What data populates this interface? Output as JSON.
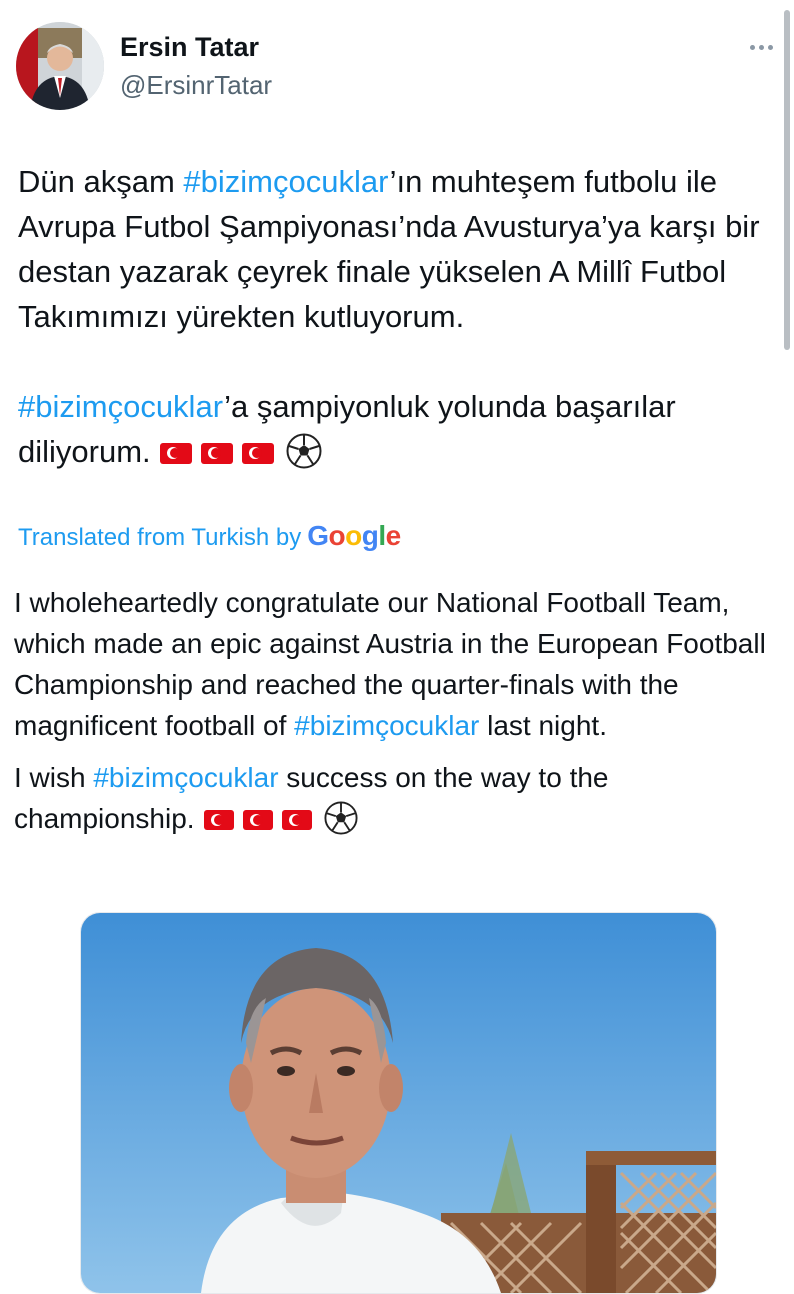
{
  "author": {
    "name": "Ersin Tatar",
    "handle": "@ErsinrTatar"
  },
  "icons": {
    "more": "more-horizontal-icon",
    "flag": "turkey-flag-emoji",
    "ball": "soccer-ball-emoji"
  },
  "tweet": {
    "p1_before": "Dün akşam ",
    "p1_tag": "#bizimçocuklar",
    "p1_after": "’ın muhteşem futbolu ile Avrupa Futbol Şampiyonası’nda Avusturya’ya karşı bir destan yazarak çeyrek finale yükselen A Millî Futbol Takımımızı yürekten kutluyorum.",
    "p2_tag": "#bizimçocuklar",
    "p2_after": "’a şampiyonluk yolunda başarılar diliyorum."
  },
  "translation": {
    "label": "Translated from Turkish by",
    "provider": "Google",
    "t1_before": "I wholeheartedly congratulate our National Football Team, which made an epic against Austria in the European Football Championship and reached the quarter-finals with the magnificent football of ",
    "t1_tag": "#bizimçocuklar",
    "t1_after": " last night.",
    "t2_before": "I wish ",
    "t2_tag": "#bizimçocuklar",
    "t2_after": " success on the way to the championship."
  },
  "colors": {
    "accent": "#1d9bf0",
    "text": "#0f1419",
    "secondary": "#536471",
    "flag_red": "#e30a17"
  }
}
